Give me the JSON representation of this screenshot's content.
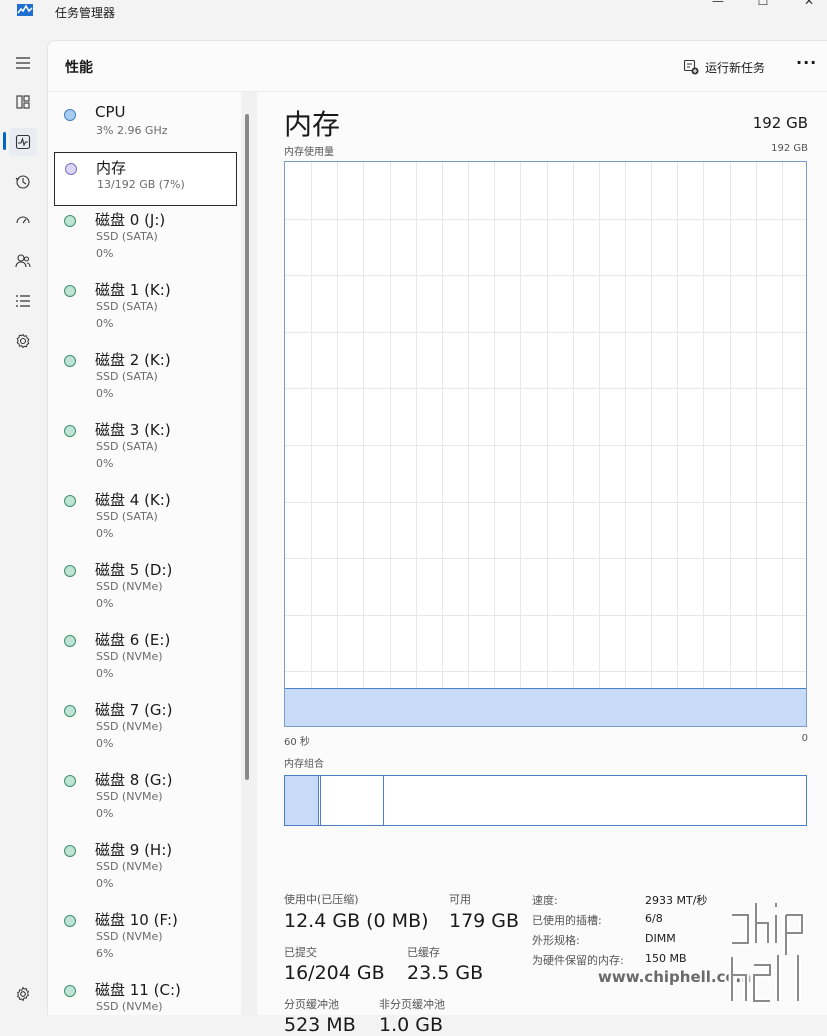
{
  "app": {
    "title": "任务管理器",
    "window_buttons": [
      "—",
      "☐",
      "✕"
    ]
  },
  "nav": [
    {
      "name": "hamburger-menu-icon"
    },
    {
      "name": "processes-icon"
    },
    {
      "name": "performance-icon",
      "active": true
    },
    {
      "name": "app-history-icon"
    },
    {
      "name": "startup-apps-icon"
    },
    {
      "name": "users-icon"
    },
    {
      "name": "details-icon"
    },
    {
      "name": "services-icon"
    },
    {
      "name": "settings-icon"
    }
  ],
  "header": {
    "title": "性能",
    "run_task": "运行新任务",
    "more": "···"
  },
  "devices": [
    {
      "name": "CPU",
      "sub1": "3%  2.96 GHz",
      "sub2": "",
      "dot_fill": "#a9cdf0",
      "dot_border": "#3f7fc4"
    },
    {
      "name": "内存",
      "sub1": "13/192 GB (7%)",
      "sub2": "",
      "dot_fill": "#d9d6f7",
      "dot_border": "#7b6fc9",
      "selected": true
    },
    {
      "name": "磁盘 0 (J:)",
      "sub1": "SSD (SATA)",
      "sub2": "0%",
      "dot_fill": "#bfe3d6",
      "dot_border": "#3f8f6f"
    },
    {
      "name": "磁盘 1 (K:)",
      "sub1": "SSD (SATA)",
      "sub2": "0%",
      "dot_fill": "#bfe3d6",
      "dot_border": "#3f8f6f"
    },
    {
      "name": "磁盘 2 (K:)",
      "sub1": "SSD (SATA)",
      "sub2": "0%",
      "dot_fill": "#bfe3d6",
      "dot_border": "#3f8f6f"
    },
    {
      "name": "磁盘 3 (K:)",
      "sub1": "SSD (SATA)",
      "sub2": "0%",
      "dot_fill": "#bfe3d6",
      "dot_border": "#3f8f6f"
    },
    {
      "name": "磁盘 4 (K:)",
      "sub1": "SSD (SATA)",
      "sub2": "0%",
      "dot_fill": "#bfe3d6",
      "dot_border": "#3f8f6f"
    },
    {
      "name": "磁盘 5 (D:)",
      "sub1": "SSD (NVMe)",
      "sub2": "0%",
      "dot_fill": "#bfe3d6",
      "dot_border": "#3f8f6f"
    },
    {
      "name": "磁盘 6 (E:)",
      "sub1": "SSD (NVMe)",
      "sub2": "0%",
      "dot_fill": "#bfe3d6",
      "dot_border": "#3f8f6f"
    },
    {
      "name": "磁盘 7 (G:)",
      "sub1": "SSD (NVMe)",
      "sub2": "0%",
      "dot_fill": "#bfe3d6",
      "dot_border": "#3f8f6f"
    },
    {
      "name": "磁盘 8 (G:)",
      "sub1": "SSD (NVMe)",
      "sub2": "0%",
      "dot_fill": "#bfe3d6",
      "dot_border": "#3f8f6f"
    },
    {
      "name": "磁盘 9 (H:)",
      "sub1": "SSD (NVMe)",
      "sub2": "0%",
      "dot_fill": "#bfe3d6",
      "dot_border": "#3f8f6f"
    },
    {
      "name": "磁盘 10 (F:)",
      "sub1": "SSD (NVMe)",
      "sub2": "6%",
      "dot_fill": "#bfe3d6",
      "dot_border": "#3f8f6f"
    },
    {
      "name": "磁盘 11 (C:)",
      "sub1": "SSD (NVMe)",
      "sub2": "",
      "dot_fill": "#bfe3d6",
      "dot_border": "#3f8f6f"
    }
  ],
  "detail": {
    "title": "内存",
    "total": "192 GB",
    "usage_label": "内存使用量",
    "usage_max": "192 GB",
    "usage_fraction": 0.065,
    "axis_left": "60 秒",
    "axis_right": "0",
    "composition_label": "内存组合",
    "composition": {
      "in_use_fraction": 0.065,
      "modified_fraction": 0.004,
      "standby_fraction": 0.122
    },
    "stats": {
      "in_use_label": "使用中(已压缩)",
      "in_use_value": "12.4 GB (0 MB)",
      "available_label": "可用",
      "available_value": "179 GB",
      "committed_label": "已提交",
      "committed_value": "16/204 GB",
      "cached_label": "已缓存",
      "cached_value": "23.5 GB",
      "paged_label": "分页缓冲池",
      "paged_value": "523 MB",
      "nonpaged_label": "非分页缓冲池",
      "nonpaged_value": "1.0 GB"
    },
    "specs": [
      {
        "k": "速度:",
        "v": "2933 MT/秒"
      },
      {
        "k": "已使用的插槽:",
        "v": "6/8"
      },
      {
        "k": "外形规格:",
        "v": "DIMM"
      },
      {
        "k": "为硬件保留的内存:",
        "v": "150 MB"
      }
    ]
  },
  "watermark": {
    "text": "www.chiphell.com"
  },
  "colors": {
    "accent": "#0067c0",
    "memory_line": "#4a80c8",
    "memory_fill": "#c7dbf8"
  }
}
